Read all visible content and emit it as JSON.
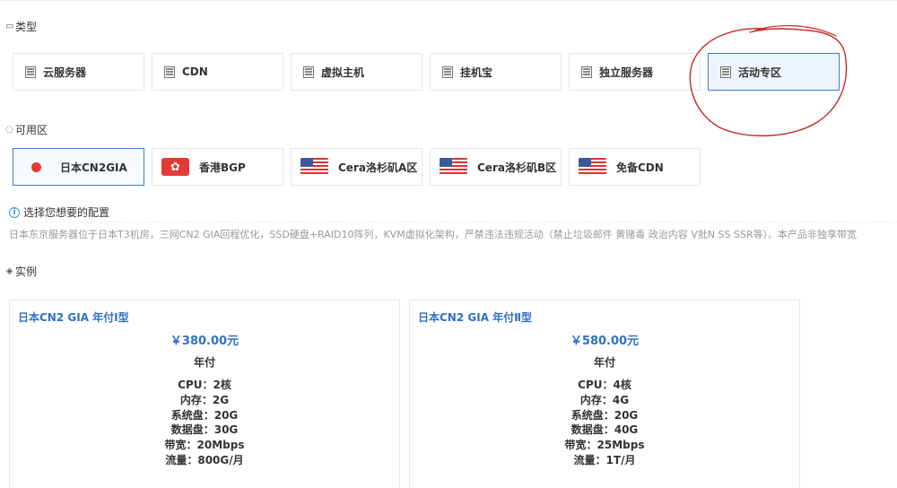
{
  "type_section": {
    "title": "类型",
    "options": [
      {
        "label": "云服务器"
      },
      {
        "label": "CDN"
      },
      {
        "label": "虚拟主机"
      },
      {
        "label": "挂机宝"
      },
      {
        "label": "独立服务器"
      },
      {
        "label": "活动专区",
        "selected": true
      }
    ]
  },
  "zone_section": {
    "title": "可用区",
    "options": [
      {
        "label": "日本CN2GIA",
        "flag": "japan",
        "selected": true
      },
      {
        "label": "香港BGP",
        "flag": "hong-kong"
      },
      {
        "label": "Cera洛杉矶A区",
        "flag": "usa"
      },
      {
        "label": "Cera洛杉矶B区",
        "flag": "usa"
      },
      {
        "label": "免备CDN",
        "flag": "usa"
      }
    ]
  },
  "config_hint": "选择您想要的配置",
  "description": "日本东京服务器位于日本T3机房，三网CN2 GIA回程优化，SSD硬盘+RAID10阵列，KVM虚拟化架构，严禁违法违规活动（禁止垃圾邮件 黄赌毒 政治内容 V批N SS SSR等）。本产品非独享带宽",
  "instance_section": {
    "title": "实例",
    "cards": [
      {
        "title": "日本CN2 GIA 年付Ⅰ型",
        "price": "￥380.00元",
        "period": "年付",
        "specs": [
          "CPU：2核",
          "内存：2G",
          "系统盘：20G",
          "数据盘：30G",
          "带宽：20Mbps",
          "流量：800G/月"
        ]
      },
      {
        "title": "日本CN2 GIA 年付Ⅱ型",
        "price": "￥580.00元",
        "period": "年付",
        "specs": [
          "CPU：4核",
          "内存：4G",
          "系统盘：20G",
          "数据盘：40G",
          "带宽：25Mbps",
          "流量：1T/月"
        ]
      }
    ]
  },
  "colors": {
    "accent": "#2f72c4",
    "selected_border": "#3a7bd5",
    "annotation": "#c62828"
  }
}
